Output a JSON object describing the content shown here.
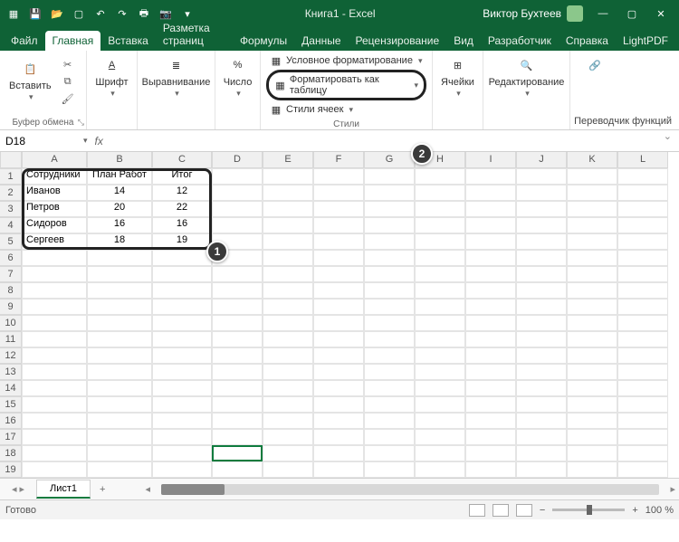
{
  "title": "Книга1 - Excel",
  "user": "Виктор Бухтеев",
  "tabs": [
    "Файл",
    "Главная",
    "Вставка",
    "Разметка страниц",
    "Формулы",
    "Данные",
    "Рецензирование",
    "Вид",
    "Разработчик",
    "Справка",
    "LightPDF"
  ],
  "active_tab": 1,
  "ribbon": {
    "clipboard": {
      "paste": "Вставить",
      "label": "Буфер обмена"
    },
    "font": {
      "btn": "Шрифт",
      "label": ""
    },
    "align": {
      "btn": "Выравнивание",
      "label": ""
    },
    "number": {
      "btn": "Число",
      "label": ""
    },
    "styles": {
      "cond": "Условное форматирование",
      "fmt": "Форматировать как таблицу",
      "cell": "Стили ячеек",
      "label": "Стили"
    },
    "cells": {
      "btn": "Ячейки",
      "label": ""
    },
    "editing": {
      "btn": "Редактирование",
      "label": ""
    },
    "translator": "Переводчик функций"
  },
  "namebox": "D18",
  "formula": "",
  "columns": [
    "A",
    "B",
    "C",
    "D",
    "E",
    "F",
    "G",
    "H",
    "I",
    "J",
    "K",
    "L"
  ],
  "rows": 19,
  "table": {
    "headers": [
      "Сотрудники",
      "План Работ",
      "Итог"
    ],
    "data": [
      [
        "Иванов",
        "14",
        "12"
      ],
      [
        "Петров",
        "20",
        "22"
      ],
      [
        "Сидоров",
        "16",
        "16"
      ],
      [
        "Сергеев",
        "18",
        "19"
      ]
    ]
  },
  "selected_cell": {
    "row": 18,
    "col": "D"
  },
  "callouts": {
    "1": "1",
    "2": "2"
  },
  "sheet": "Лист1",
  "status": "Готово",
  "zoom": "100 %"
}
